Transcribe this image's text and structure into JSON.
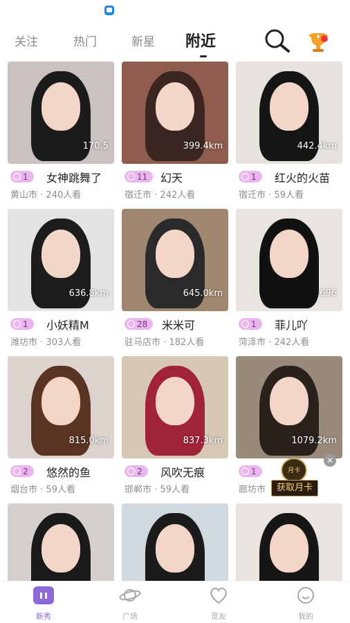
{
  "tabs": {
    "follow": "关注",
    "hot": "热门",
    "new_star": "新星",
    "nearby": "附近"
  },
  "cards": [
    {
      "badge": "1",
      "name": "女神跳舞了",
      "city": "黄山市",
      "viewers": "240人看",
      "dist": "170.5",
      "bg": "#c9c2c0",
      "hair": "#1b1b1b"
    },
    {
      "badge": "11",
      "name": "幻天",
      "city": "宿迁市",
      "viewers": "242人看",
      "dist": "399.4km",
      "bg": "#8f5c4d",
      "hair": "#3a2520"
    },
    {
      "badge": "1",
      "name": "红火的火苗",
      "city": "宿迁市",
      "viewers": "59人看",
      "dist": "442.4km",
      "bg": "#e6e3de",
      "hair": "#151515"
    },
    {
      "badge": "1",
      "name": "小妖精M",
      "city": "潍坊市",
      "viewers": "303人看",
      "dist": "636.8km",
      "bg": "#e3e3e3",
      "hair": "#1c1c1c"
    },
    {
      "badge": "28",
      "name": "米米可",
      "city": "驻马店市",
      "viewers": "182人看",
      "dist": "645.0km",
      "bg": "#a08770",
      "hair": "#2a2a2a"
    },
    {
      "badge": "1",
      "name": "菲儿吖",
      "city": "菏泽市",
      "viewers": "242人看",
      "dist": "696",
      "bg": "#e8e4e0",
      "hair": "#111"
    },
    {
      "badge": "2",
      "name": "悠然的鱼",
      "city": "烟台市",
      "viewers": "59人看",
      "dist": "815.0km",
      "bg": "#dcd3cf",
      "hair": "#5a3422"
    },
    {
      "badge": "2",
      "name": "风吹无痕",
      "city": "邯郸市",
      "viewers": "59人看",
      "dist": "837.3km",
      "bg": "#d7c8b6",
      "hair": "#a1233a"
    },
    {
      "badge": "1",
      "name": "",
      "city": "廊坊市",
      "viewers": "",
      "dist": "1079.2km",
      "bg": "#9a8a7c",
      "hair": "#2a211d"
    },
    {
      "badge": "",
      "name": "",
      "city": "",
      "viewers": "",
      "dist": "",
      "bg": "#d6d0cc",
      "hair": "#1a1a1a"
    },
    {
      "badge": "",
      "name": "",
      "city": "",
      "viewers": "",
      "dist": "",
      "bg": "#cfd9de",
      "hair": "#1b1b1b"
    },
    {
      "badge": "",
      "name": "",
      "city": "",
      "viewers": "",
      "dist": "",
      "bg": "#e9e4df",
      "hair": "#161616"
    }
  ],
  "promo": {
    "coin_label": "月卡",
    "banner": "获取月卡",
    "close": "✕"
  },
  "nav": [
    {
      "label": "新秀",
      "icon": "home-icon"
    },
    {
      "label": "广场",
      "icon": "planet-icon"
    },
    {
      "label": "觅友",
      "icon": "heart-icon"
    },
    {
      "label": "我的",
      "icon": "smile-icon"
    }
  ],
  "colors": {
    "accent": "#8d6ad8",
    "badge_bg": "#e9b7ee"
  }
}
